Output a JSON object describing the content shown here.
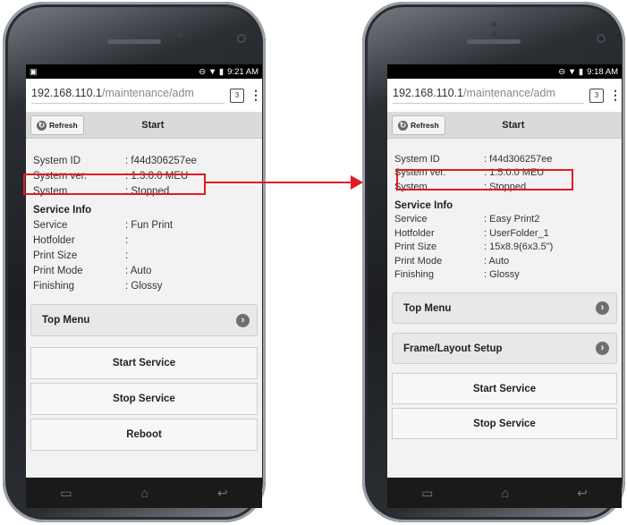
{
  "left": {
    "statusbar": {
      "left_icon": "▣",
      "icons": "⊖ ▼ ▮",
      "time": "9:21 AM"
    },
    "url": {
      "host": "192.168.110.1",
      "path": "/maintenance/adm"
    },
    "tab_count": "3",
    "header": {
      "refresh": "Refresh",
      "title": "Start"
    },
    "system_rows": [
      {
        "k": "System ID",
        "v": ":  f44d306257ee"
      },
      {
        "k": "System ver.",
        "v": ":  1.3.0.0 MEU"
      },
      {
        "k": "System",
        "v": ":  Stopped"
      }
    ],
    "service_title": "Service Info",
    "service_rows": [
      {
        "k": "Service",
        "v": ":  Fun Print"
      },
      {
        "k": "Hotfolder",
        "v": ":"
      },
      {
        "k": "Print Size",
        "v": ":"
      },
      {
        "k": "Print Mode",
        "v": ":  Auto"
      },
      {
        "k": "Finishing",
        "v": ":  Glossy"
      }
    ],
    "top_menu": "Top Menu",
    "buttons": [
      "Start Service",
      "Stop Service",
      "Reboot"
    ]
  },
  "right": {
    "statusbar": {
      "icons": "⊖ ▼ ▮",
      "time": "9:18 AM"
    },
    "url": {
      "host": "192.168.110.1",
      "path": "/maintenance/adm"
    },
    "tab_count": "3",
    "header": {
      "refresh": "Refresh",
      "title": "Start"
    },
    "system_rows": [
      {
        "k": "System ID",
        "v": ":  f44d306257ee"
      },
      {
        "k": "System ver.",
        "v": ":  1.5.0.0 MEU"
      },
      {
        "k": "System",
        "v": ":  Stopped"
      }
    ],
    "service_title": "Service Info",
    "service_rows": [
      {
        "k": "Service",
        "v": ":  Easy Print2"
      },
      {
        "k": "Hotfolder",
        "v": ":  UserFolder_1"
      },
      {
        "k": "Print Size",
        "v": ":  15x8.9(6x3.5\")"
      },
      {
        "k": "Print Mode",
        "v": ":  Auto"
      },
      {
        "k": "Finishing",
        "v": ":  Glossy"
      }
    ],
    "top_menu": "Top Menu",
    "frame_setup": "Frame/Layout Setup",
    "buttons": [
      "Start Service",
      "Stop Service"
    ]
  },
  "icons": {
    "refresh": "refresh-icon",
    "chevron": "chevron-right-icon",
    "nav": [
      "recent-apps-icon",
      "home-icon",
      "back-icon"
    ]
  },
  "colors": {
    "highlight": "#e11b22"
  }
}
